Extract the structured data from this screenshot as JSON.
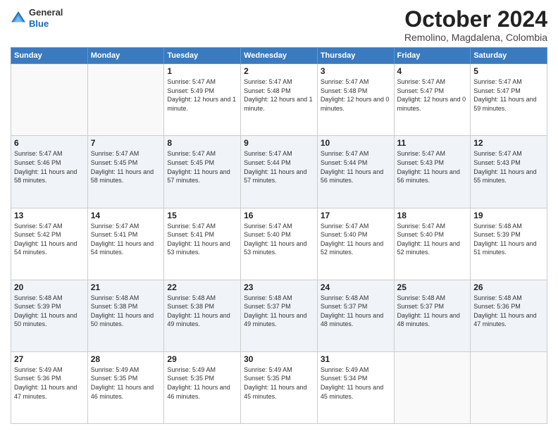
{
  "header": {
    "logo_general": "General",
    "logo_blue": "Blue",
    "month_title": "October 2024",
    "subtitle": "Remolino, Magdalena, Colombia"
  },
  "days_of_week": [
    "Sunday",
    "Monday",
    "Tuesday",
    "Wednesday",
    "Thursday",
    "Friday",
    "Saturday"
  ],
  "weeks": [
    [
      {
        "day": "",
        "info": ""
      },
      {
        "day": "",
        "info": ""
      },
      {
        "day": "1",
        "info": "Sunrise: 5:47 AM\nSunset: 5:49 PM\nDaylight: 12 hours\nand 1 minute."
      },
      {
        "day": "2",
        "info": "Sunrise: 5:47 AM\nSunset: 5:48 PM\nDaylight: 12 hours\nand 1 minute."
      },
      {
        "day": "3",
        "info": "Sunrise: 5:47 AM\nSunset: 5:48 PM\nDaylight: 12 hours\nand 0 minutes."
      },
      {
        "day": "4",
        "info": "Sunrise: 5:47 AM\nSunset: 5:47 PM\nDaylight: 12 hours\nand 0 minutes."
      },
      {
        "day": "5",
        "info": "Sunrise: 5:47 AM\nSunset: 5:47 PM\nDaylight: 11 hours\nand 59 minutes."
      }
    ],
    [
      {
        "day": "6",
        "info": "Sunrise: 5:47 AM\nSunset: 5:46 PM\nDaylight: 11 hours\nand 58 minutes."
      },
      {
        "day": "7",
        "info": "Sunrise: 5:47 AM\nSunset: 5:45 PM\nDaylight: 11 hours\nand 58 minutes."
      },
      {
        "day": "8",
        "info": "Sunrise: 5:47 AM\nSunset: 5:45 PM\nDaylight: 11 hours\nand 57 minutes."
      },
      {
        "day": "9",
        "info": "Sunrise: 5:47 AM\nSunset: 5:44 PM\nDaylight: 11 hours\nand 57 minutes."
      },
      {
        "day": "10",
        "info": "Sunrise: 5:47 AM\nSunset: 5:44 PM\nDaylight: 11 hours\nand 56 minutes."
      },
      {
        "day": "11",
        "info": "Sunrise: 5:47 AM\nSunset: 5:43 PM\nDaylight: 11 hours\nand 56 minutes."
      },
      {
        "day": "12",
        "info": "Sunrise: 5:47 AM\nSunset: 5:43 PM\nDaylight: 11 hours\nand 55 minutes."
      }
    ],
    [
      {
        "day": "13",
        "info": "Sunrise: 5:47 AM\nSunset: 5:42 PM\nDaylight: 11 hours\nand 54 minutes."
      },
      {
        "day": "14",
        "info": "Sunrise: 5:47 AM\nSunset: 5:41 PM\nDaylight: 11 hours\nand 54 minutes."
      },
      {
        "day": "15",
        "info": "Sunrise: 5:47 AM\nSunset: 5:41 PM\nDaylight: 11 hours\nand 53 minutes."
      },
      {
        "day": "16",
        "info": "Sunrise: 5:47 AM\nSunset: 5:40 PM\nDaylight: 11 hours\nand 53 minutes."
      },
      {
        "day": "17",
        "info": "Sunrise: 5:47 AM\nSunset: 5:40 PM\nDaylight: 11 hours\nand 52 minutes."
      },
      {
        "day": "18",
        "info": "Sunrise: 5:47 AM\nSunset: 5:40 PM\nDaylight: 11 hours\nand 52 minutes."
      },
      {
        "day": "19",
        "info": "Sunrise: 5:48 AM\nSunset: 5:39 PM\nDaylight: 11 hours\nand 51 minutes."
      }
    ],
    [
      {
        "day": "20",
        "info": "Sunrise: 5:48 AM\nSunset: 5:39 PM\nDaylight: 11 hours\nand 50 minutes."
      },
      {
        "day": "21",
        "info": "Sunrise: 5:48 AM\nSunset: 5:38 PM\nDaylight: 11 hours\nand 50 minutes."
      },
      {
        "day": "22",
        "info": "Sunrise: 5:48 AM\nSunset: 5:38 PM\nDaylight: 11 hours\nand 49 minutes."
      },
      {
        "day": "23",
        "info": "Sunrise: 5:48 AM\nSunset: 5:37 PM\nDaylight: 11 hours\nand 49 minutes."
      },
      {
        "day": "24",
        "info": "Sunrise: 5:48 AM\nSunset: 5:37 PM\nDaylight: 11 hours\nand 48 minutes."
      },
      {
        "day": "25",
        "info": "Sunrise: 5:48 AM\nSunset: 5:37 PM\nDaylight: 11 hours\nand 48 minutes."
      },
      {
        "day": "26",
        "info": "Sunrise: 5:48 AM\nSunset: 5:36 PM\nDaylight: 11 hours\nand 47 minutes."
      }
    ],
    [
      {
        "day": "27",
        "info": "Sunrise: 5:49 AM\nSunset: 5:36 PM\nDaylight: 11 hours\nand 47 minutes."
      },
      {
        "day": "28",
        "info": "Sunrise: 5:49 AM\nSunset: 5:35 PM\nDaylight: 11 hours\nand 46 minutes."
      },
      {
        "day": "29",
        "info": "Sunrise: 5:49 AM\nSunset: 5:35 PM\nDaylight: 11 hours\nand 46 minutes."
      },
      {
        "day": "30",
        "info": "Sunrise: 5:49 AM\nSunset: 5:35 PM\nDaylight: 11 hours\nand 45 minutes."
      },
      {
        "day": "31",
        "info": "Sunrise: 5:49 AM\nSunset: 5:34 PM\nDaylight: 11 hours\nand 45 minutes."
      },
      {
        "day": "",
        "info": ""
      },
      {
        "day": "",
        "info": ""
      }
    ]
  ]
}
